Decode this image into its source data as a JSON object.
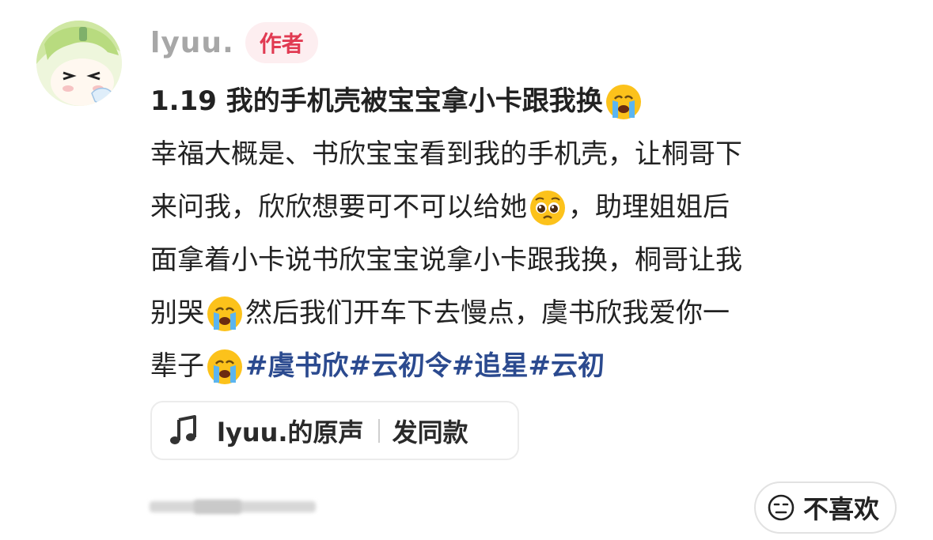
{
  "author": {
    "name": "lyuu.",
    "badge": "作者"
  },
  "post": {
    "line1": "1.19 我的手机壳被宝宝拿小卡跟我换",
    "line2": "幸福大概是、书欣宝宝看到我的手机壳，让桐哥下",
    "line3a": "来问我，欣欣想要可不可以给她",
    "line3b": "，助理姐姐后",
    "line4": "面拿着小卡说书欣宝宝说拿小卡跟我换，桐哥让我",
    "line5a": "别哭",
    "line5b": "然后我们开车下去慢点，虞书欣我爱你一",
    "line6a": "辈子",
    "hashtags": [
      "#虞书欣",
      "#云初令",
      "#追星",
      "#云初"
    ]
  },
  "music": {
    "label": "lyuu.的原声",
    "action": "发同款"
  },
  "dislike": {
    "label": "不喜欢"
  },
  "colors": {
    "hashtag": "#2b4a8f",
    "badge_text": "#e13a52",
    "badge_bg": "#fdeef0"
  },
  "icons": [
    "avatar",
    "crying-emoji",
    "pleading-emoji",
    "music-note-icon",
    "neutral-face-icon"
  ]
}
